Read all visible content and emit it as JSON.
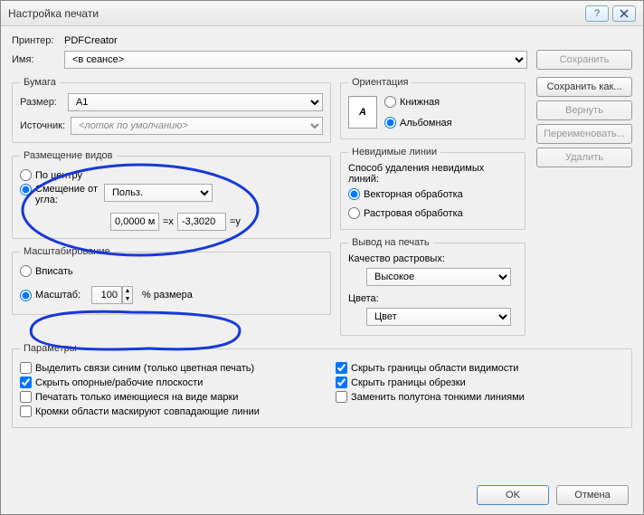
{
  "title": "Настройка печати",
  "printer": {
    "label": "Принтер:",
    "value": "PDFCreator"
  },
  "name": {
    "label": "Имя:",
    "value": "<в сеансе>"
  },
  "right_buttons": {
    "save": "Сохранить",
    "save_as": "Сохранить как...",
    "revert": "Вернуть",
    "rename": "Переименовать...",
    "delete": "Удалить"
  },
  "paper": {
    "legend": "Бумага",
    "size_label": "Размер:",
    "size_value": "A1",
    "source_label": "Источник:",
    "source_value": "<лоток по умолчанию>"
  },
  "orientation": {
    "legend": "Ориентация",
    "portrait": "Книжная",
    "landscape": "Альбомная",
    "glyph": "A"
  },
  "placement": {
    "legend": "Размещение видов",
    "center": "По центру",
    "offset": "Смещение от угла:",
    "mode": "Польз.",
    "x_val": "0,0000 м",
    "x_suffix": "=x",
    "y_val": "-3,3020",
    "y_suffix": "=y"
  },
  "hidden": {
    "legend": "Невидимые линии",
    "mode_label": "Способ удаления невидимых линий:",
    "vector": "Векторная обработка",
    "raster": "Растровая обработка"
  },
  "scale": {
    "legend": "Масштабирование",
    "fit": "Вписать",
    "zoom": "Масштаб:",
    "value": "100",
    "suffix": "% размера"
  },
  "output": {
    "legend": "Вывод на печать",
    "quality_label": "Качество растровых:",
    "quality_value": "Высокое",
    "colors_label": "Цвета:",
    "colors_value": "Цвет"
  },
  "options": {
    "legend": "Параметры",
    "opt1": "Выделить связи синим (только цветная печать)",
    "opt2": "Скрыть опорные/рабочие плоскости",
    "opt3": "Печатать только имеющиеся на виде марки",
    "opt4": "Кромки области маскируют совпадающие линии",
    "opt5": "Скрыть границы области видимости",
    "opt6": "Скрыть границы обрезки",
    "opt7": "Заменить полутона тонкими линиями"
  },
  "footer": {
    "ok": "OK",
    "cancel": "Отмена"
  }
}
